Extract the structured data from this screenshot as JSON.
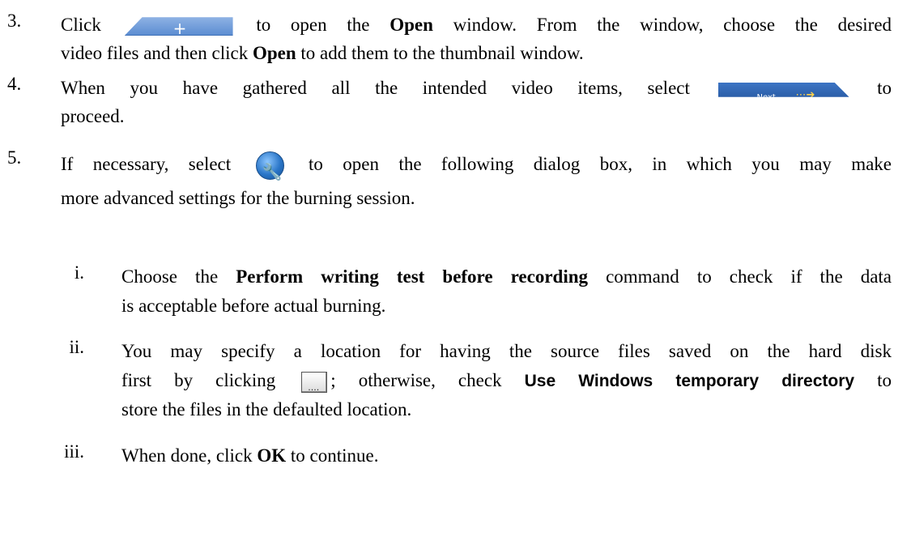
{
  "step3": {
    "num": "3.",
    "l1_a": "Click",
    "icon": "add-plus-button-icon",
    "l1_b": "to open the",
    "l1_bold": "Open",
    "l1_c": "window. From the window, choose the desired",
    "l2_a": "video files and then click",
    "l2_bold": "Open",
    "l2_b": "to add them to the thumbnail window."
  },
  "step4": {
    "num": "4.",
    "l1_a": "When you have gathered all the intended video items, select",
    "icon": "next-arrow-button-icon",
    "icon_label": "Next",
    "l1_b": "to",
    "l2_a": "proceed."
  },
  "step5": {
    "num": "5.",
    "l1_a": "If necessary, select",
    "icon": "wrench-settings-icon",
    "l1_b": "to open the following dialog box, in which you may make",
    "l2_a": "more advanced settings for the burning session.",
    "sub": [
      {
        "num": "i.",
        "l1_a": "Choose the",
        "l1_bold": "Perform writing test before recording",
        "l1_b": "command to check if the data",
        "l2_a": "is acceptable before actual burning."
      },
      {
        "num": "ii.",
        "l1_a": "You may specify a location for having the source files saved on the hard disk",
        "l2_a": "first by clicking",
        "icon": "browse-ellipsis-button-icon",
        "l2_b": "; otherwise, check",
        "l2_bold": "Use Windows temporary directory",
        "l2_c": "to",
        "l3_a": "store the files in the defaulted location."
      },
      {
        "num": "iii.",
        "l1_a": "When done, click",
        "l1_bold": "OK",
        "l1_b": "to continue."
      }
    ]
  }
}
